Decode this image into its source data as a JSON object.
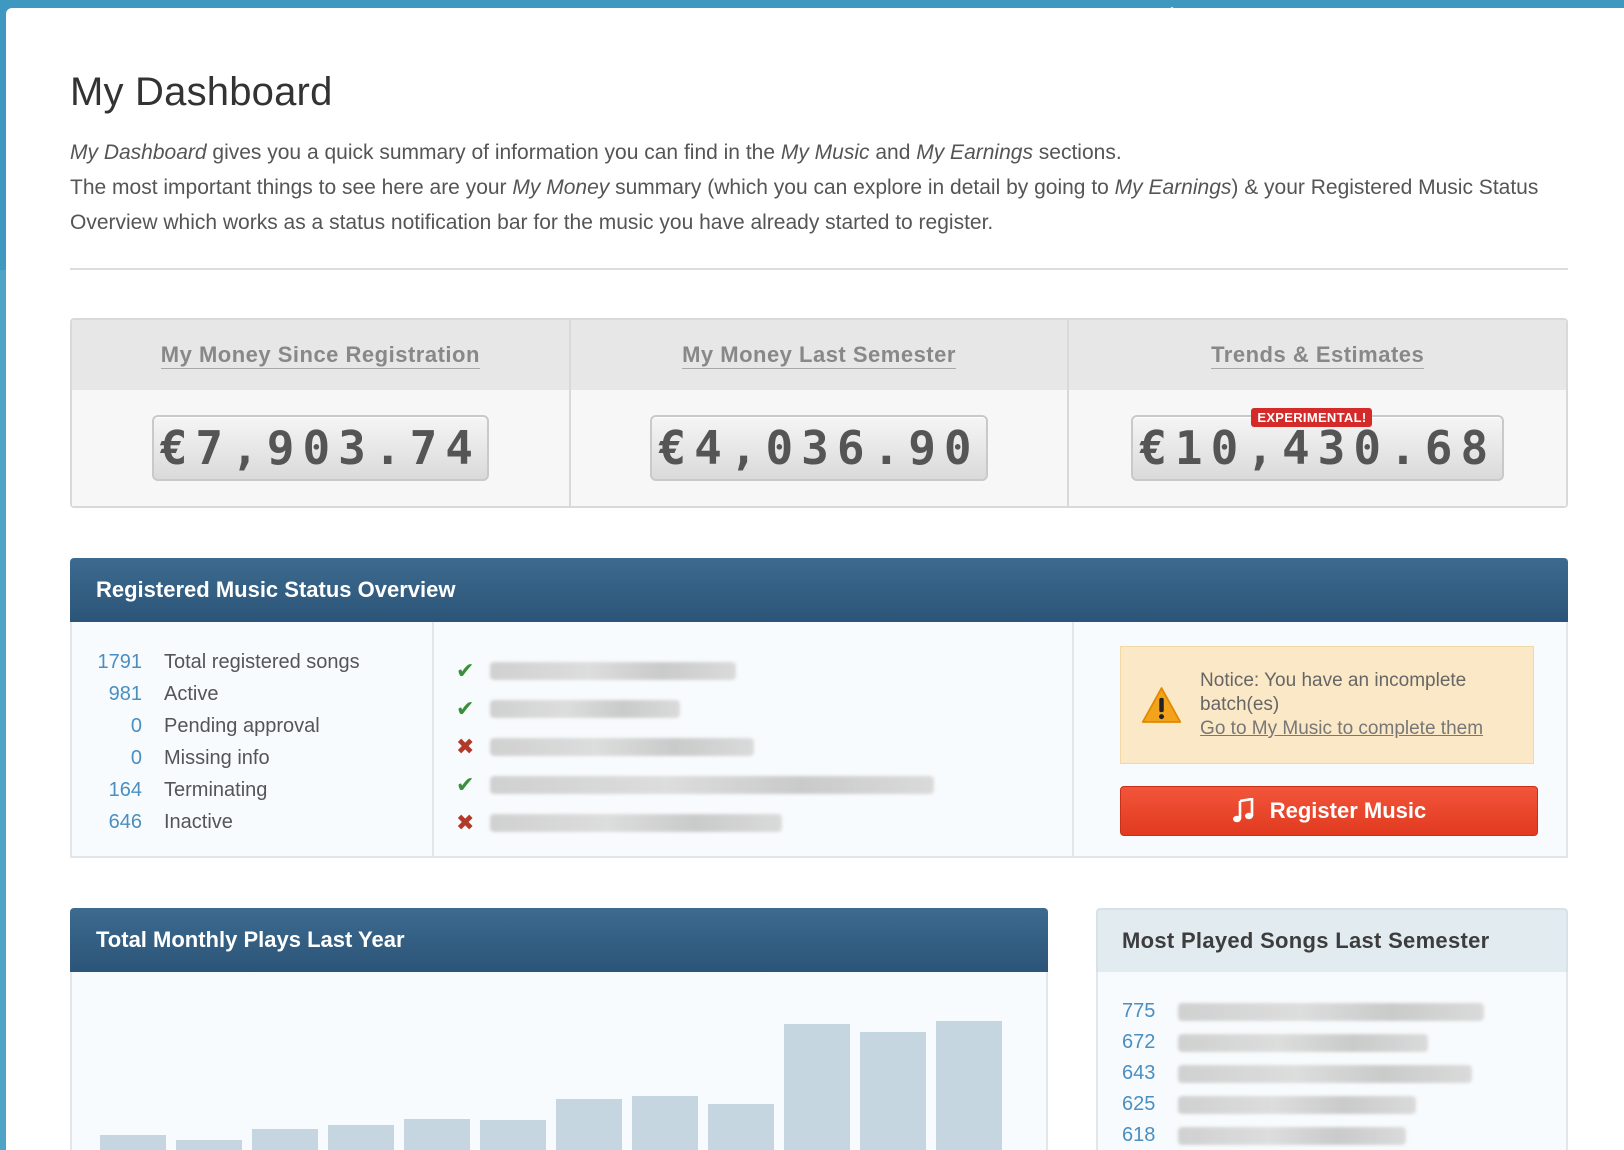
{
  "header": {
    "title": "My Dashboard"
  },
  "intro": {
    "line1": {
      "em1": "My Dashboard",
      "t1": " gives you a quick summary of information you can find in the ",
      "em2": "My Music",
      "t2": " and ",
      "em3": "My Earnings",
      "t3": " sections."
    },
    "line2": {
      "t1": "The most important things to see here are your ",
      "em1": "My Money",
      "t2": " summary (which you can explore in detail by going to ",
      "em2": "My Earnings",
      "t3": ") & your Registered Music Status Overview which works as a status notification bar for the music you have already started to register."
    }
  },
  "money": [
    {
      "label": "My Money Since Registration",
      "value": "€7,903.74"
    },
    {
      "label": "My Money Last Semester",
      "value": "€4,036.90"
    },
    {
      "label": "Trends & Estimates",
      "value": "€10,430.68",
      "badge": "EXPERIMENTAL!"
    }
  ],
  "status": {
    "title": "Registered Music Status Overview",
    "stats": [
      {
        "num": "1791",
        "label": "Total registered songs"
      },
      {
        "num": "981",
        "label": "Active"
      },
      {
        "num": "0",
        "label": "Pending approval"
      },
      {
        "num": "0",
        "label": "Missing info"
      },
      {
        "num": "164",
        "label": "Terminating"
      },
      {
        "num": "646",
        "label": "Inactive"
      }
    ],
    "songs": [
      {
        "status": "ok"
      },
      {
        "status": "ok"
      },
      {
        "status": "error"
      },
      {
        "status": "ok"
      },
      {
        "status": "error"
      }
    ],
    "notice": {
      "text": "Notice: You have an incomplete batch(es)",
      "link": "Go to My Music to complete them"
    },
    "register_button": "Register Music"
  },
  "plays": {
    "title": "Total Monthly Plays Last Year",
    "chart_data": {
      "type": "bar",
      "values": [
        27,
        22,
        33,
        37,
        43,
        42,
        63,
        66,
        58,
        138,
        130,
        141
      ]
    }
  },
  "most_played": {
    "title": "Most Played Songs Last Semester",
    "rows": [
      {
        "num": "775"
      },
      {
        "num": "672"
      },
      {
        "num": "643"
      },
      {
        "num": "625"
      },
      {
        "num": "618"
      }
    ]
  },
  "colors": {
    "accent": "#2b5578",
    "register": "#e13a1f",
    "stat_number": "#4a8fc0",
    "ok": "#3b8f3b",
    "error": "#b23a2a"
  }
}
